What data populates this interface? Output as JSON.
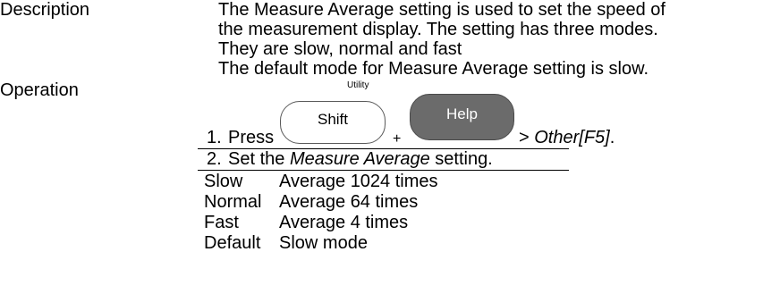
{
  "left_labels": {
    "description": "Description",
    "operation": "Operation"
  },
  "description": {
    "line1": "The Measure Average setting is used to set the speed of",
    "line2": "the measurement display. The setting has three modes.",
    "line3": "They are slow, normal and fast",
    "line4": "The default mode for Measure Average setting is slow."
  },
  "step1": {
    "number": "1.",
    "press": "Press",
    "shift_label": "Shift",
    "plus": "+",
    "utility_label": "Utility",
    "help_label": "Help",
    "after": "> ",
    "menu_ref": "Other[F5]",
    "end": "."
  },
  "step2": {
    "number": "2.",
    "pre": "Set the ",
    "setting_name": "Measure Average",
    "post": " setting."
  },
  "modes": [
    {
      "mode": "Slow",
      "detail": "Average 1024 times"
    },
    {
      "mode": "Normal",
      "detail": "Average 64 times"
    },
    {
      "mode": "Fast",
      "detail": "Average 4 times"
    },
    {
      "mode": "Default",
      "detail": "Slow mode"
    }
  ]
}
